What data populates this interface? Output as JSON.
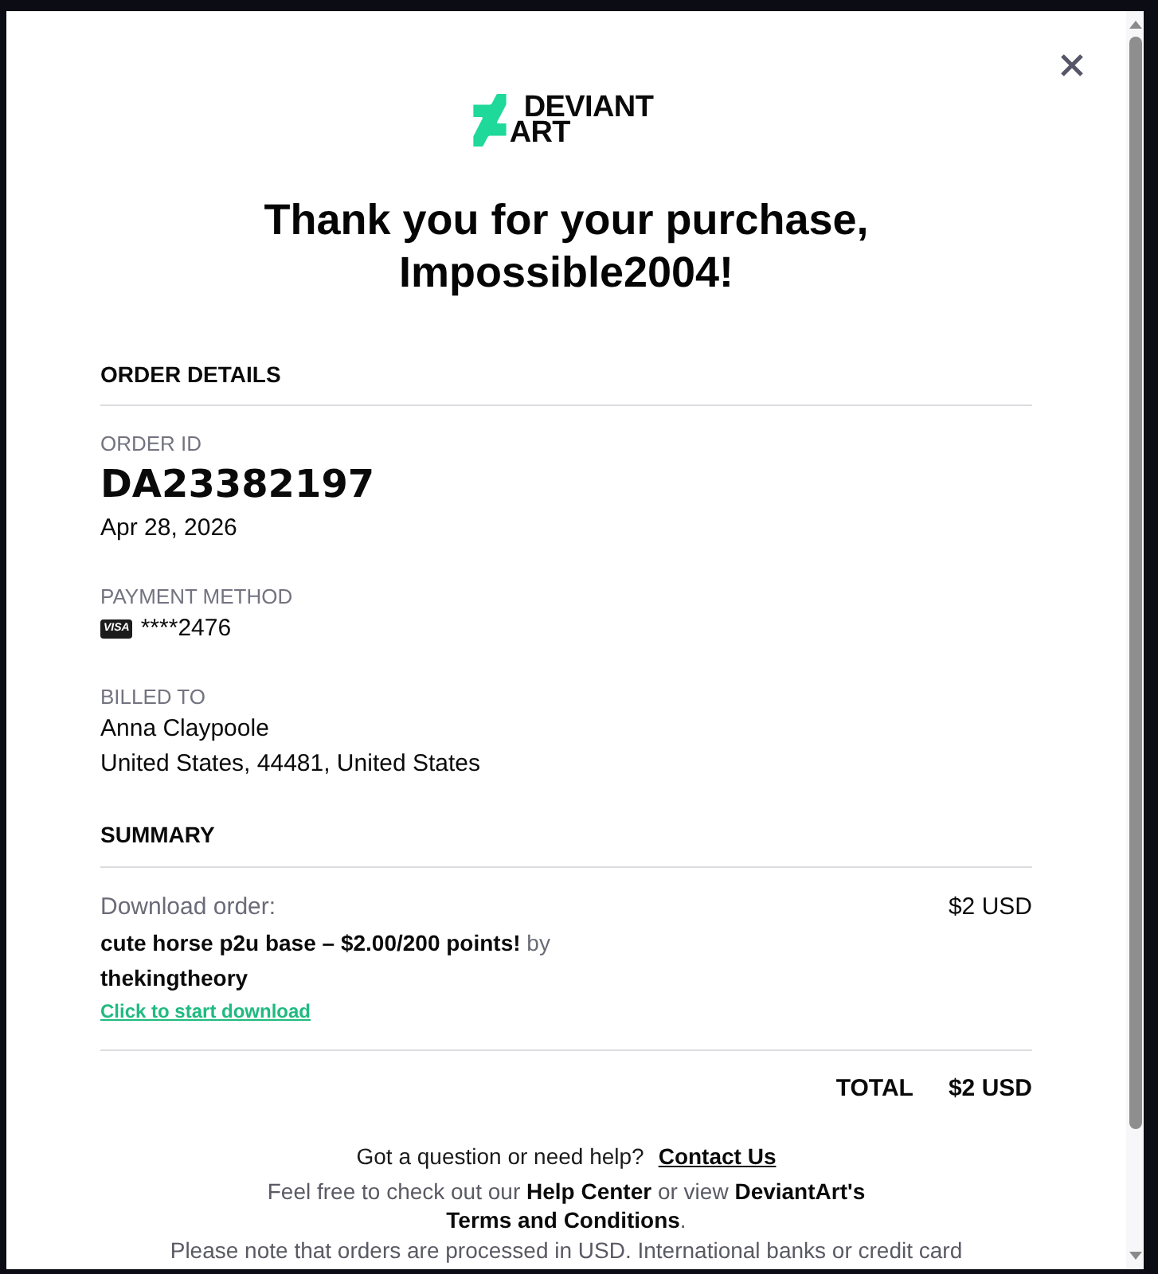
{
  "logo": {
    "wordmark_lines": [
      "DEVIANT",
      "ART"
    ]
  },
  "heading": "Thank you for your purchase, Impossible2004!",
  "order_details": {
    "title": "ORDER DETAILS",
    "order_id": {
      "label": "ORDER ID",
      "value": "DA23382197",
      "date": "Apr 28, 2026"
    },
    "payment_method": {
      "label": "PAYMENT METHOD",
      "card_brand": "VISA",
      "card_number": "****2476"
    },
    "billed_to": {
      "label": "BILLED TO",
      "lines": [
        "Anna Claypoole",
        "United States, 44481, United States"
      ]
    }
  },
  "summary": {
    "title": "SUMMARY",
    "items": [
      {
        "label": "Download order:",
        "description": "**cute horse p2u base – $2.00/200 points!** by **thekingtheory**",
        "link": "Click to start download",
        "price": "$2 USD"
      }
    ],
    "total": {
      "label": "TOTAL",
      "value": "$2 USD"
    }
  },
  "footer": {
    "question": "Got a question or need help?",
    "contact_link": "Contact Us",
    "help_text": "Feel free to check out our **Help Center** or view **DeviantArt's Terms and Conditions**.",
    "note": "Please note that orders are processed in USD. International banks or credit card"
  }
}
